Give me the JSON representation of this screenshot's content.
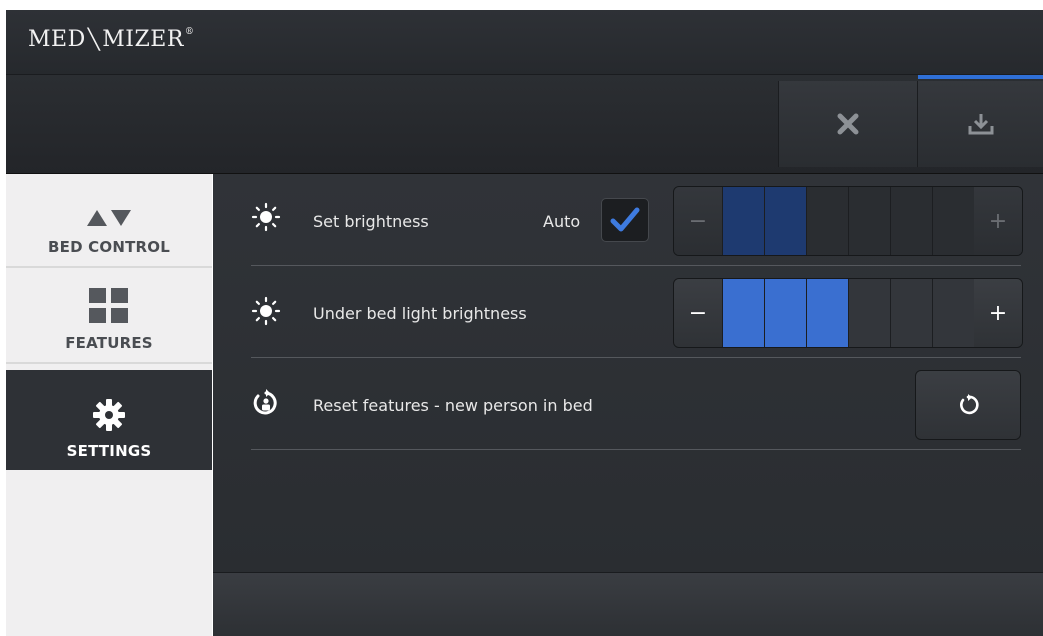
{
  "brand": {
    "name_left": "MED",
    "name_right": "MIZER",
    "reg": "®"
  },
  "toolbar": {
    "close_icon": "close-icon",
    "save_icon": "download-icon"
  },
  "sidebar": {
    "items": [
      {
        "label": "BED CONTROL",
        "icon": "up-down-arrows-icon"
      },
      {
        "label": "FEATURES",
        "icon": "grid-icon"
      },
      {
        "label": "SETTINGS",
        "icon": "gear-icon",
        "active": true
      }
    ]
  },
  "settings": {
    "brightness": {
      "label": "Set brightness",
      "auto_label": "Auto",
      "auto_checked": true,
      "level": 2,
      "max": 6,
      "enabled": false
    },
    "under_bed": {
      "label": "Under bed light brightness",
      "level": 3,
      "max": 6,
      "enabled": true
    },
    "reset": {
      "label": "Reset features - new person in bed"
    }
  },
  "stepper_labels": {
    "minus": "−",
    "plus": "+"
  },
  "colors": {
    "accent": "#3a6fd0",
    "check": "#3e7be0"
  }
}
